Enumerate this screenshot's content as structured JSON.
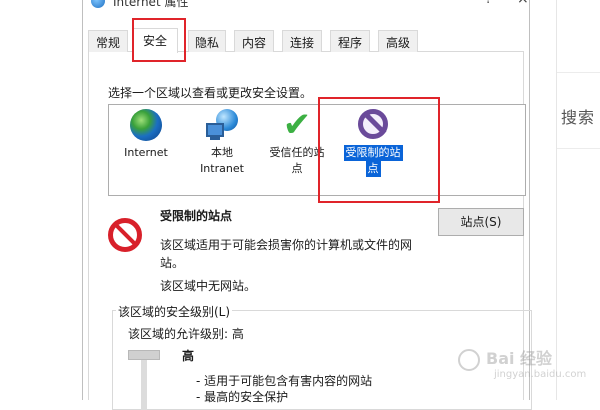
{
  "window": {
    "title": "Internet 属性",
    "help": "?",
    "close": "×"
  },
  "tabs": [
    "常规",
    "安全",
    "隐私",
    "内容",
    "连接",
    "程序",
    "高级"
  ],
  "security": {
    "instruction": "选择一个区域以查看或更改安全设置。",
    "zones": [
      {
        "line1": "Internet",
        "line2": "",
        "icon": "globe-icon"
      },
      {
        "line1": "本地",
        "line2": "Intranet",
        "icon": "intranet-icon"
      },
      {
        "line1": "受信任的站",
        "line2": "点",
        "icon": "checkmark-icon"
      },
      {
        "line1": "受限制的站",
        "line2": "点",
        "icon": "restricted-icon",
        "selected": true
      }
    ],
    "selected_zone": {
      "name": "受限制的站点",
      "description": "该区域适用于可能会损害你的计算机或文件的网站。",
      "no_sites": "该区域中无网站。"
    },
    "sites_button": "站点(S)",
    "level_group": {
      "title": "该区域的安全级别(L)",
      "allowed": "该区域的允许级别: 高",
      "level": "高",
      "bullets": [
        "- 适用于可能包含有害内容的网站",
        "- 最高的安全保护"
      ]
    }
  },
  "background": {
    "search_text": "搜索"
  },
  "watermark": {
    "text": "Bai 经验",
    "url": "jingyan.baidu.com"
  },
  "colors": {
    "highlight_box": "#e0242a",
    "selection": "#0a64d8"
  }
}
